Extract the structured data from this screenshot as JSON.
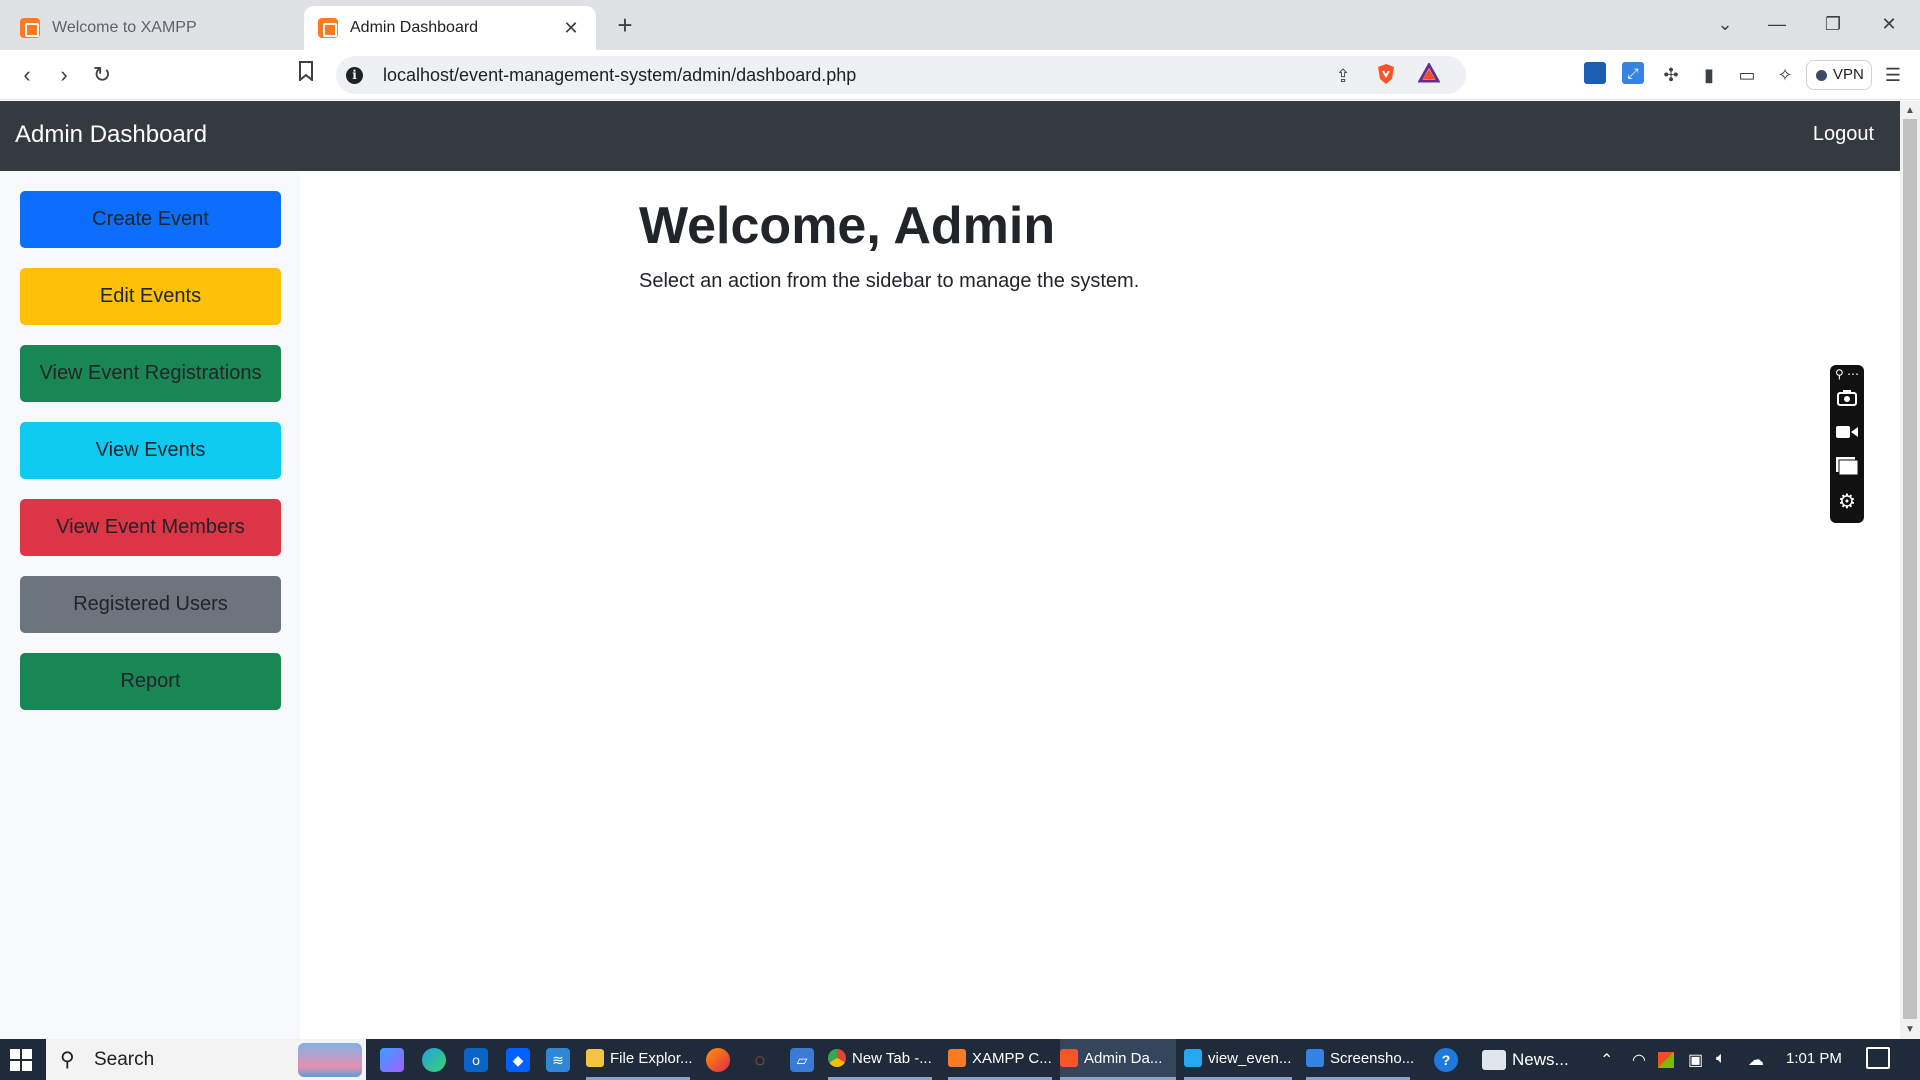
{
  "browser": {
    "tabs": [
      {
        "label": "Welcome to XAMPP"
      },
      {
        "label": "Admin Dashboard",
        "close": "✕"
      }
    ],
    "new_tab": "+",
    "url": "localhost/event-management-system/admin/dashboard.php",
    "vpn_label": "VPN"
  },
  "page": {
    "navbar": {
      "brand": "Admin Dashboard",
      "logout": "Logout"
    },
    "sidebar": {
      "buttons": [
        {
          "label": "Create Event",
          "bg": "#0d6efd",
          "color": "#212529"
        },
        {
          "label": "Edit Events",
          "bg": "#ffc107",
          "color": "#212529"
        },
        {
          "label": "View Event Registrations",
          "bg": "#198754",
          "color": "#212529"
        },
        {
          "label": "View Events",
          "bg": "#0dcaf0",
          "color": "#212529"
        },
        {
          "label": "View Event Members",
          "bg": "#dc3545",
          "color": "#212529"
        },
        {
          "label": "Registered Users",
          "bg": "#6c757d",
          "color": "#212529"
        },
        {
          "label": "Report",
          "bg": "#198754",
          "color": "#212529"
        }
      ]
    },
    "main": {
      "heading": "Welcome, Admin",
      "subtitle": "Select an action from the sidebar to manage the system."
    }
  },
  "taskbar": {
    "search_label": "Search",
    "apps": [
      {
        "label": "File Explor..."
      },
      {
        "label": "New Tab -..."
      },
      {
        "label": "XAMPP C..."
      },
      {
        "label": "Admin Da..."
      },
      {
        "label": "view_even..."
      },
      {
        "label": "Screensho..."
      },
      {
        "label": "News..."
      }
    ],
    "time": "1:01 PM"
  }
}
